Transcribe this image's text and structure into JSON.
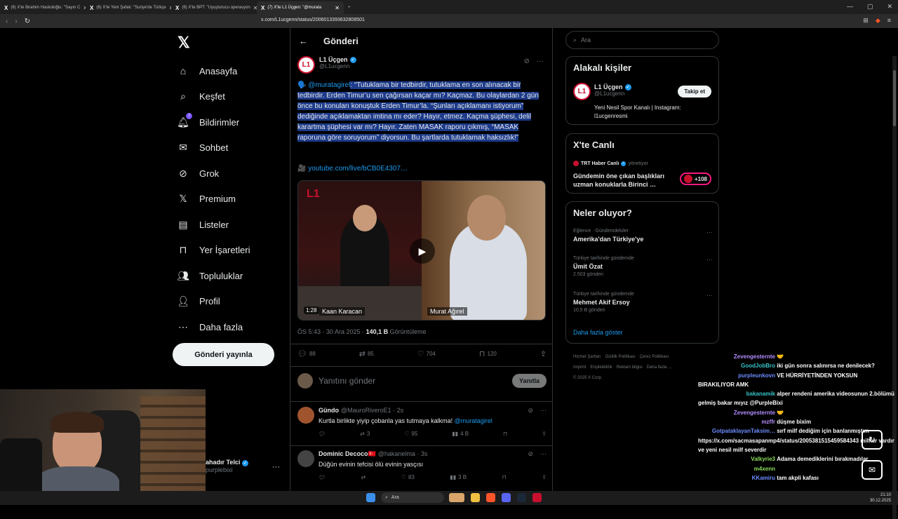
{
  "browser": {
    "tabs": [
      {
        "title": "(6) X'te İbrahim Haskoloğlu: \"Sayın C",
        "active": false
      },
      {
        "title": "(6) X'te Yeni Şafak: \"Suriye'de Türkçe",
        "active": false
      },
      {
        "title": "(6) X'te BPT: \"Uyuşturucu operasyon",
        "active": false
      },
      {
        "title": "(7) X'te L1 Üçgen: \"@murata",
        "active": true
      }
    ],
    "url": "x.com/L1ucgenn/status/2006013393632808501"
  },
  "nav": {
    "items": [
      {
        "label": "Anasayfa",
        "icon": "home-icon"
      },
      {
        "label": "Keşfet",
        "icon": "search-icon"
      },
      {
        "label": "Bildirimler",
        "icon": "bell-icon",
        "badge": "7"
      },
      {
        "label": "Sohbet",
        "icon": "mail-icon"
      },
      {
        "label": "Grok",
        "icon": "grok-icon"
      },
      {
        "label": "Premium",
        "icon": "x-icon"
      },
      {
        "label": "Listeler",
        "icon": "list-icon"
      },
      {
        "label": "Yer İşaretleri",
        "icon": "bookmark-icon"
      },
      {
        "label": "Topluluklar",
        "icon": "community-icon"
      },
      {
        "label": "Profil",
        "icon": "profile-icon"
      },
      {
        "label": "Daha fazla",
        "icon": "more-icon"
      }
    ],
    "post_button": "Gönderi yayınla",
    "profile_name": "ahadır Telci",
    "profile_handle": "purplebixi"
  },
  "main": {
    "title": "Gönderi",
    "tweet": {
      "author_name": "L1 Üçgen",
      "author_handle": "@L1ucgenn",
      "mention": "@muratagirel",
      "text": ": “Tutuklama bir tedbirdir, tutuklama en son alınacak bir tedbirdir. Erden Timur’u sen çağırsan kaçar mı? Kaçmaz. Bu olaylardan 2 gün önce bu konuları konuştuk Erden Timur’la. “Şunları açıklamanı istiyorum” dediğinde açıklamaktan imtina mı eder? Hayır, etmez. Kaçma şüphesi, delil karartma şüphesi var mı? Hayır. Zaten MASAK raporu çıkmış, “MASAK raporuna göre soruyorum” diyorsun. Bu şartlarda tutuklamak haksızlık!”",
      "link": "youtube.com/live/bCB0E4307…",
      "video_duration": "1:28",
      "video_caption_left": "Kaan Karacan",
      "video_caption_right": "Murat Ağırel",
      "time": "ÖS 5:43 · 30 Ara 2025 · ",
      "views": "140,1 B",
      "views_label": " Görüntüleme",
      "stats": {
        "replies": "88",
        "reposts": "85",
        "likes": "704",
        "bookmarks": "120"
      }
    },
    "reply_placeholder": "Yanıtını gönder",
    "reply_button": "Yanıtla",
    "replies": [
      {
        "name": "Gündo",
        "handle": "@MauroRiveroE1 · 2s",
        "text": "Kurtla birlikte yiyip çobanla yas tutmaya kalkma!",
        "mention": "@muratagirel",
        "reposts": "3",
        "likes": "95",
        "views": "4 B"
      },
      {
        "name": "Dominic Decoco🇹🇷",
        "handle": "@hakanelma · 3s",
        "text": "Düğün evinin tefcisi ölü evinin yasçısı",
        "mention": "",
        "reposts": "",
        "likes": "83",
        "views": "3 B"
      }
    ]
  },
  "right": {
    "search_placeholder": "Ara",
    "related_title": "Alakalı kişiler",
    "related": {
      "name": "L1 Üçgen",
      "handle": "@L1ucgenn",
      "bio": "Yeni Nesil Spor Kanalı | Instagram: l1ucgenresmi",
      "follow": "Takip et"
    },
    "live_title": "X'te Canlı",
    "live": {
      "host": "TRT Haber Canlı",
      "role": "yönetiyor",
      "desc": "Gündemin öne çıkan başlıkları uzman konuklarla Birinci …",
      "count": "+108"
    },
    "trends_title": "Neler oluyor?",
    "trends": [
      {
        "context": "Eğlence · Gündemdekiler",
        "title": "Amerika'dan Türkiye'ye",
        "count": ""
      },
      {
        "context": "Türkiye tarihinde gündemde",
        "title": "Ümit Özat",
        "count": "2.503 gönderi"
      },
      {
        "context": "Türkiye tarihinde gündemde",
        "title": "Mehmet Akif Ersoy",
        "count": "10,5 B gönderi"
      }
    ],
    "show_more": "Daha fazla göster",
    "footer": [
      "Hizmet Şartları",
      "Gizlilik Politikası",
      "Çerez Politikası",
      "Imprint",
      "Erişilebilirlik",
      "Reklam bilgisi",
      "Daha fazla …",
      "© 2025 X Corp."
    ]
  },
  "chat": [
    {
      "user": "Zevengesternte",
      "color": "#b48cff",
      "msg": "🤝"
    },
    {
      "user": "GoodJobBro",
      "color": "#38c3c7",
      "msg": "iki gün sonra salınırsa ne denilecek?"
    },
    {
      "user": "purpleunkovn",
      "color": "#6d8cff",
      "msg": "VE HÜRRİYETİNDEN YOKSUN BIRAKILIYOR AMK"
    },
    {
      "user": "bakanamik",
      "color": "#38c3c7",
      "msg": "alper rendeni amerika videosunun 2.bölümü gelmiş bakar mıyız @PurpleBixi"
    },
    {
      "user": "Zevengesternte",
      "color": "#b48cff",
      "msg": "🤝"
    },
    {
      "user": "mzffr",
      "color": "#b48cff",
      "msg": "düşme bixim"
    },
    {
      "user": "GotpataklayanTaksim…",
      "color": "#6d8cff",
      "msg": "sırf milf dediğim için banlanmıştım https://x.com/sacmasapanmp4/status/2005381515459584343 milfler vardır ve yeni nesil milf severdir"
    },
    {
      "user": "Valkyrie3",
      "color": "#8bdc5c",
      "msg": "Adama demediklerini bırakmadılar"
    },
    {
      "user": "m4xenn",
      "color": "#8bdc5c",
      "msg": ""
    },
    {
      "user": "KKamiru",
      "color": "#6d8cff",
      "msg": "tam akpli kafası"
    }
  ],
  "taskbar": {
    "search": "Ara",
    "time": "21:10",
    "date": "30.12.2025"
  }
}
